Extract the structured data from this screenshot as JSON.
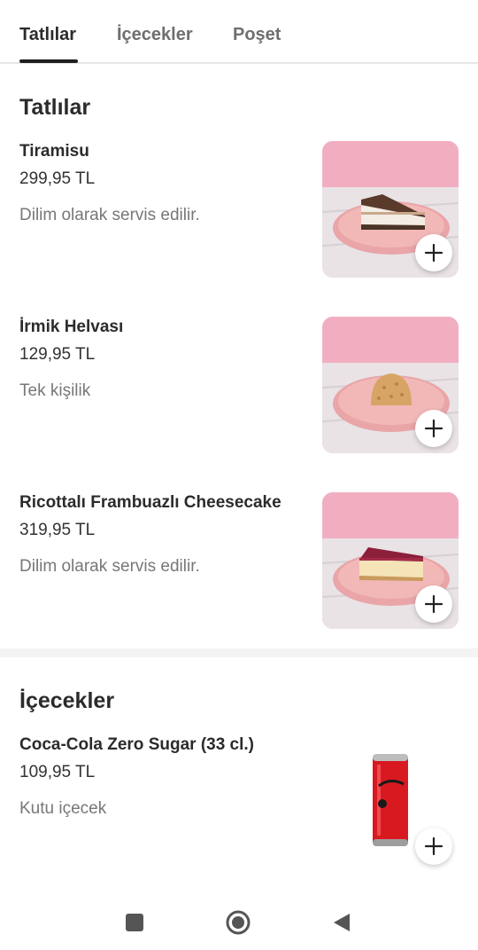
{
  "tabs": [
    {
      "label": "Tatlılar",
      "active": true
    },
    {
      "label": "İçecekler",
      "active": false
    },
    {
      "label": "Poşet",
      "active": false
    }
  ],
  "sections": [
    {
      "title": "Tatlılar",
      "products": [
        {
          "name": "Tiramisu",
          "price": "299,95 TL",
          "description": "Dilim olarak servis edilir.",
          "image": "tiramisu-slice"
        },
        {
          "name": "İrmik Helvası",
          "price": "129,95 TL",
          "description": "Tek kişilik",
          "image": "semolina-halva"
        },
        {
          "name": "Ricottalı Frambuazlı Cheesecake",
          "price": "319,95 TL",
          "description": "Dilim olarak servis edilir.",
          "image": "raspberry-cheesecake-slice"
        }
      ]
    },
    {
      "title": "İçecekler",
      "products": [
        {
          "name": "Coca-Cola Zero Sugar (33 cl.)",
          "price": "109,95 TL",
          "description": "Kutu içecek",
          "image": "coca-cola-can"
        }
      ]
    }
  ],
  "icons": {
    "add": "plus-icon",
    "nav_recents": "square-icon",
    "nav_home": "circle-icon",
    "nav_back": "triangle-back-icon"
  },
  "colors": {
    "text_primary": "#2b2b2b",
    "text_secondary": "#777777",
    "tab_indicator": "#1f1f1f",
    "image_background": "#f2b6c6"
  }
}
